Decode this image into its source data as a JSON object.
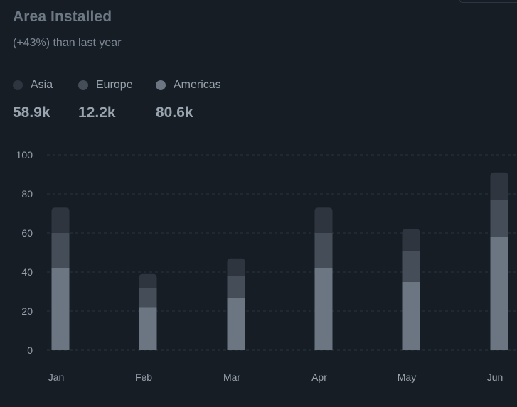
{
  "header": {
    "title": "Area Installed",
    "subtitle": "(+43%) than last year"
  },
  "legend": [
    {
      "name": "Asia",
      "value": "58.9k",
      "color": "#2e353f"
    },
    {
      "name": "Europe",
      "value": "12.2k",
      "color": "#454d58"
    },
    {
      "name": "Americas",
      "value": "80.6k",
      "color": "#6b7682"
    }
  ],
  "chart_data": {
    "type": "bar",
    "stacked": true,
    "categories": [
      "Jan",
      "Feb",
      "Mar",
      "Apr",
      "May",
      "Jun"
    ],
    "series": [
      {
        "name": "Americas",
        "color": "#6b7682",
        "values": [
          42,
          22,
          27,
          42,
          35,
          58
        ]
      },
      {
        "name": "Europe",
        "color": "#454d58",
        "values": [
          18,
          10,
          11,
          18,
          16,
          19
        ]
      },
      {
        "name": "Asia",
        "color": "#2e353f",
        "values": [
          13,
          7,
          9,
          13,
          11,
          14
        ]
      }
    ],
    "yticks": [
      "0",
      "20",
      "40",
      "60",
      "80",
      "100"
    ],
    "ylim": [
      0,
      100
    ],
    "grid": true,
    "xlabel": "",
    "ylabel": ""
  }
}
